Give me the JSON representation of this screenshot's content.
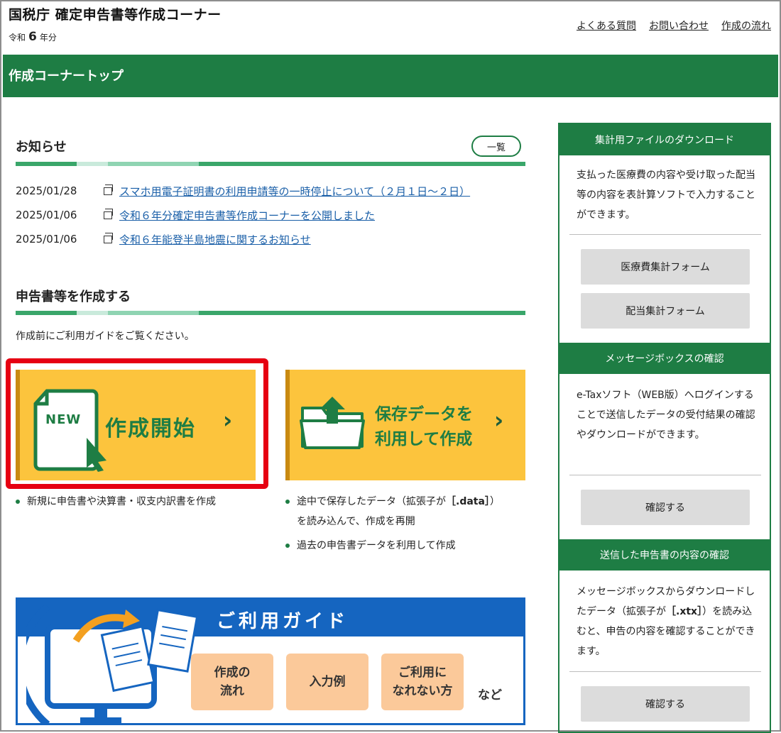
{
  "header": {
    "site_title": "国税庁 確定申告書等作成コーナー",
    "year_prefix": "令和",
    "year_number": "6",
    "year_suffix": "年分",
    "links": [
      "よくある質問",
      "お問い合わせ",
      "作成の流れ"
    ]
  },
  "page_bar": {
    "label": "作成コーナートップ"
  },
  "news": {
    "heading": "お知らせ",
    "list_button": "一覧",
    "items": [
      {
        "date": "2025/01/28",
        "text": "スマホ用電子証明書の利用申請等の一時停止について（２月１日～２日）"
      },
      {
        "date": "2025/01/06",
        "text": "令和６年分確定申告書等作成コーナーを公開しました"
      },
      {
        "date": "2025/01/06",
        "text": "令和６年能登半島地震に関するお知らせ"
      }
    ]
  },
  "create": {
    "heading": "申告書等を作成する",
    "note": "作成前にご利用ガイドをご覧ください。",
    "new_card": {
      "icon_text": "NEW",
      "label": "作成開始",
      "bullets": [
        "新規に申告書や決算書・収支内訳書を作成"
      ]
    },
    "save_card": {
      "label_line1": "保存データを",
      "label_line2": "利用して作成",
      "bullet1_pre": "途中で保存したデータ（拡張子が",
      "bullet1_ext": "［.data］",
      "bullet1_post": "）",
      "bullet1_line2": "を読み込んで、作成を再開",
      "bullet2": "過去の申告書データを利用して作成"
    }
  },
  "guide_banner": {
    "title": "ご利用ガイド",
    "buttons": [
      {
        "line1": "作成の",
        "line2": "流れ"
      },
      {
        "line1": "入力例",
        "line2": ""
      },
      {
        "line1": "ご利用に",
        "line2": "なれない方"
      }
    ],
    "etc": "など"
  },
  "sidebar": {
    "sections": [
      {
        "title": "集計用ファイルのダウンロード",
        "text": "支払った医療費の内容や受け取った配当等の内容を表計算ソフトで入力することができます。",
        "buttons": [
          "医療費集計フォーム",
          "配当集計フォーム"
        ]
      },
      {
        "title": "メッセージボックスの確認",
        "text": "e-Taxソフト（WEB版）へログインすることで送信したデータの受付結果の確認やダウンロードができます。",
        "buttons": [
          "確認する"
        ]
      },
      {
        "title": "送信した申告書の内容の確認",
        "text_pre": "メッセージボックスからダウンロードしたデータ（拡張子が",
        "text_ext": "［.xtx］",
        "text_post": "）を読み込むと、申告の内容を確認することができます。",
        "buttons": [
          "確認する"
        ]
      }
    ]
  },
  "colors": {
    "brand_green": "#1e7d44",
    "card_yellow": "#fcc43d",
    "highlight_red": "#e60012",
    "guide_blue": "#1565c0"
  }
}
